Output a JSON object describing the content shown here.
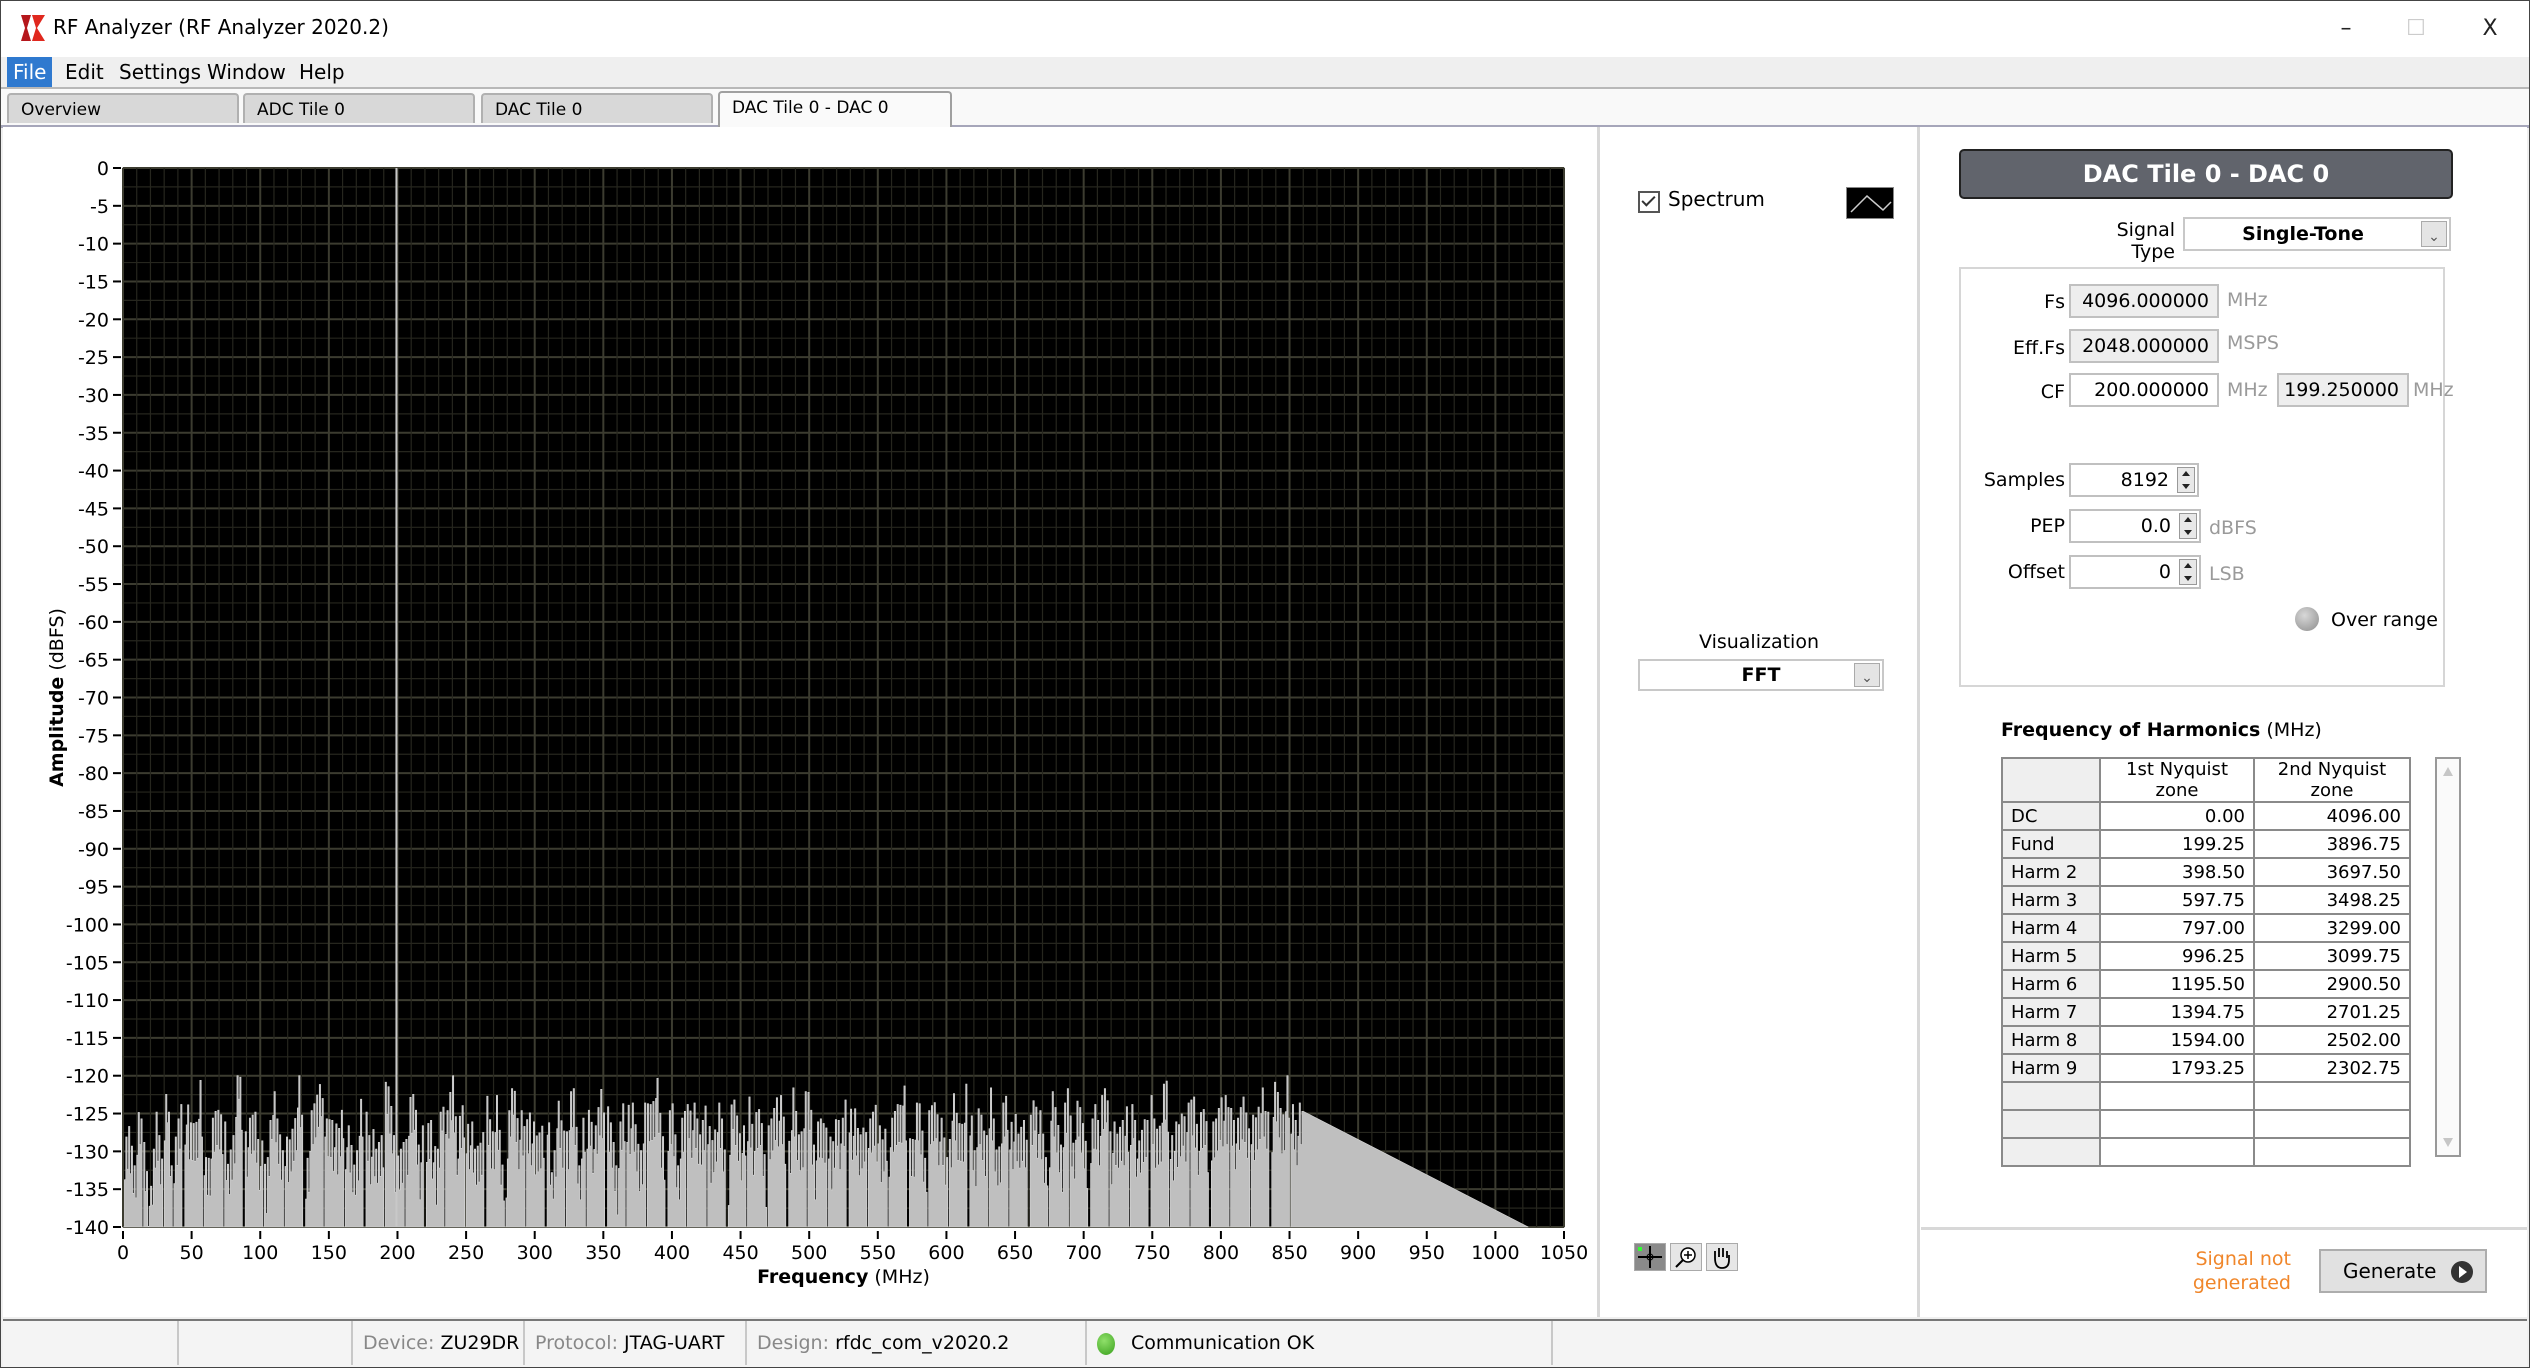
{
  "window": {
    "title": "RF Analyzer (RF Analyzer 2020.2)",
    "controls": {
      "minimize": "–",
      "maximize": "☐",
      "close": "X"
    }
  },
  "menu": [
    {
      "label": "File",
      "active": true
    },
    {
      "label": "Edit"
    },
    {
      "label": "Settings"
    },
    {
      "label": "Window"
    },
    {
      "label": "Help"
    }
  ],
  "tabs": [
    {
      "label": "Overview"
    },
    {
      "label": "ADC Tile 0"
    },
    {
      "label": "DAC Tile 0"
    },
    {
      "label": "DAC Tile 0 - DAC 0",
      "active": true
    }
  ],
  "plot_controls": {
    "spectrum_label": "Spectrum",
    "spectrum_checked": true,
    "visualization_label": "Visualization",
    "visualization_value": "FFT",
    "tools": [
      "cursor-tool",
      "zoom-tool",
      "pan-tool"
    ]
  },
  "chart_data": {
    "type": "bar",
    "title": "",
    "xlabel_bold": "Frequency",
    "xlabel_unit": " (MHz)",
    "ylabel_bold": "Amplitude",
    "ylabel_unit": " (dBFS)",
    "xlim": [
      0,
      1050
    ],
    "ylim": [
      -140,
      0
    ],
    "xticks": [
      0,
      50,
      100,
      150,
      200,
      250,
      300,
      350,
      400,
      450,
      500,
      550,
      600,
      650,
      700,
      750,
      800,
      850,
      900,
      950,
      1000,
      1050
    ],
    "yticks": [
      0,
      -5,
      -10,
      -15,
      -20,
      -25,
      -30,
      -35,
      -40,
      -45,
      -50,
      -55,
      -60,
      -65,
      -70,
      -75,
      -80,
      -85,
      -90,
      -95,
      -100,
      -105,
      -110,
      -115,
      -120,
      -125,
      -130,
      -135,
      -140
    ],
    "grid": true,
    "background": "#000000",
    "bar_color": "#bfbfbf",
    "series": [
      {
        "name": "Spectrum",
        "fundamental_freq_mhz": 199.25,
        "fundamental_dbfs": 0,
        "data_span_mhz": [
          0,
          1024
        ],
        "noise_floor_dbfs": [
          -140,
          -121
        ],
        "noise_sample_step_mhz": 4,
        "noise_dbfs": [
          -135,
          -130,
          -133,
          -128,
          -132,
          -139,
          -127,
          -131,
          -124,
          -136,
          -129,
          -123,
          -130,
          -128,
          -125,
          -133,
          -131,
          -127,
          -126,
          -135,
          -129,
          -122,
          -128,
          -130,
          -127,
          -132,
          -136,
          -124,
          -129,
          -131,
          -133,
          -128,
          -123,
          -134,
          -130,
          -126,
          -121,
          -129,
          -127,
          -132,
          -125,
          -131,
          -134,
          -128,
          -126,
          -130,
          -133,
          -129,
          -124,
          -127,
          -135,
          -131,
          -128,
          -125,
          -132,
          -130,
          -127,
          -136,
          -124,
          -129,
          -122,
          -131,
          -126,
          -128,
          -133,
          -130,
          -125,
          -129,
          -127,
          -134,
          -131,
          -123,
          -128,
          -130,
          -126,
          -132,
          -129,
          -124,
          -135,
          -127,
          -130,
          -128,
          -125,
          -133,
          -129,
          -126,
          -131,
          -124,
          -128,
          -130,
          -134,
          -127,
          -125,
          -129,
          -132,
          -128,
          -126,
          -123,
          -130,
          -131,
          -127,
          -133,
          -129,
          -125,
          -128,
          -130,
          -124,
          -132,
          -127,
          -129,
          -135,
          -126,
          -128,
          -131,
          -125,
          -130,
          -127,
          -133,
          -129,
          -124,
          -128,
          -131,
          -126,
          -130,
          -127,
          -125,
          -132,
          -129,
          -128,
          -134,
          -126,
          -130,
          -123,
          -128,
          -131,
          -127,
          -129,
          -125,
          -133,
          -128,
          -130,
          -126,
          -124,
          -131,
          -129,
          -127,
          -132,
          -128,
          -125,
          -130,
          -133,
          -126,
          -129,
          -127,
          -124,
          -131,
          -128,
          -130,
          -126,
          -132,
          -129,
          -125,
          -128,
          -131,
          -127,
          -130,
          -124,
          -129,
          -133,
          -126,
          -128,
          -131,
          -125,
          -130,
          -127,
          -129,
          -132,
          -126,
          -128,
          -124,
          -130,
          -131,
          -127,
          -129,
          -125,
          -133,
          -128,
          -126,
          -130,
          -127,
          -124,
          -129,
          -131,
          -126,
          -128,
          -125,
          -130,
          -127,
          -132,
          -129,
          -124,
          -128,
          -126,
          -130,
          -125,
          -127,
          -129,
          -124,
          -128,
          -126,
          -125,
          -127,
          -124,
          -126,
          -128
        ]
      }
    ]
  },
  "dac_panel": {
    "header": "DAC Tile 0 - DAC 0",
    "signal_type_label": "Signal Type",
    "signal_type_value": "Single-Tone",
    "fs_label": "Fs",
    "fs_value": "4096.000000",
    "fs_unit": "MHz",
    "efffs_label": "Eff.Fs",
    "efffs_value": "2048.000000",
    "efffs_unit": "MSPS",
    "cf_label": "CF",
    "cf_value": "200.000000",
    "cf_unit": "MHz",
    "cf_actual_value": "199.250000",
    "cf_actual_unit": "MHz",
    "samples_label": "Samples",
    "samples_value": "8192",
    "pep_label": "PEP",
    "pep_value": "0.0",
    "pep_unit": "dBFS",
    "offset_label": "Offset",
    "offset_value": "0",
    "offset_unit": "LSB",
    "over_range_label": "Over range"
  },
  "harmonics": {
    "title_bold": "Frequency of Harmonics",
    "title_unit": " (MHz)",
    "columns": [
      "",
      "1st Nyquist zone",
      "2nd Nyquist zone"
    ],
    "rows": [
      [
        "DC",
        "0.00",
        "4096.00"
      ],
      [
        "Fund",
        "199.25",
        "3896.75"
      ],
      [
        "Harm 2",
        "398.50",
        "3697.50"
      ],
      [
        "Harm 3",
        "597.75",
        "3498.25"
      ],
      [
        "Harm 4",
        "797.00",
        "3299.00"
      ],
      [
        "Harm 5",
        "996.25",
        "3099.75"
      ],
      [
        "Harm 6",
        "1195.50",
        "2900.50"
      ],
      [
        "Harm 7",
        "1394.75",
        "2701.25"
      ],
      [
        "Harm 8",
        "1594.00",
        "2502.00"
      ],
      [
        "Harm 9",
        "1793.25",
        "2302.75"
      ],
      [
        "",
        "",
        ""
      ],
      [
        "",
        "",
        ""
      ],
      [
        "",
        "",
        ""
      ]
    ]
  },
  "generate": {
    "status": "Signal not generated",
    "status_color": "#f0862a",
    "button_label": "Generate"
  },
  "statusbar": {
    "device_key": "Device:",
    "device_value": "ZU29DR",
    "protocol_key": "Protocol:",
    "protocol_value": "JTAG-UART",
    "design_key": "Design:",
    "design_value": "rfdc_com_v2020.2",
    "comm_status": "Communication OK",
    "comm_color": "#4cb82a"
  }
}
